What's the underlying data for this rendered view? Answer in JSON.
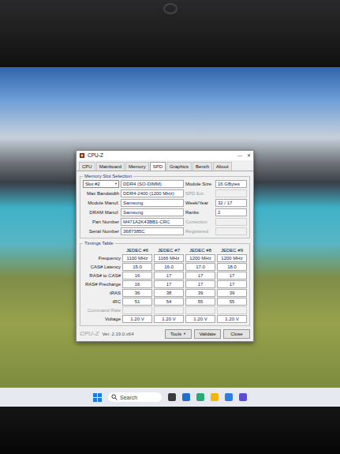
{
  "window": {
    "title": "CPU-Z",
    "controls": [
      "—",
      "✕"
    ]
  },
  "tabs": [
    {
      "label": "CPU",
      "selected": false
    },
    {
      "label": "Mainboard",
      "selected": false
    },
    {
      "label": "Memory",
      "selected": false
    },
    {
      "label": "SPD",
      "selected": true
    },
    {
      "label": "Graphics",
      "selected": false
    },
    {
      "label": "Bench",
      "selected": false
    },
    {
      "label": "About",
      "selected": false
    }
  ],
  "slot_selection": {
    "group_label": "Memory Slot Selection",
    "slot": "Slot #2",
    "arrow": "▼",
    "type": "DDR4 (SO-DIMM)",
    "size_label": "Module Size",
    "size_value": "16 GBytes",
    "rows": [
      {
        "label": "Max Bandwidth",
        "value": "DDR4-2400 (1200 MHz)",
        "side_label": "SPD Ext.",
        "side_value": "",
        "side_disabled": true
      },
      {
        "label": "Module Manuf.",
        "value": "Samsung",
        "side_label": "Week/Year",
        "side_value": "32 / 17",
        "side_disabled": false
      },
      {
        "label": "DRAM Manuf.",
        "value": "Samsung",
        "side_label": "Ranks",
        "side_value": "2",
        "side_disabled": false
      },
      {
        "label": "Part Number",
        "value": "M471A2K43BB1-CRC",
        "side_label": "Correction",
        "side_value": "",
        "side_disabled": true
      },
      {
        "label": "Serial Number",
        "value": "3687385C",
        "side_label": "Registered",
        "side_value": "",
        "side_disabled": true
      }
    ]
  },
  "timings": {
    "group_label": "Timings Table",
    "columns": [
      "JEDEC #6",
      "JEDEC #7",
      "JEDEC #8",
      "JEDEC #9"
    ],
    "rows": [
      {
        "label": "Frequency",
        "values": [
          "1100 MHz",
          "1166 MHz",
          "1200 MHz",
          "1200 MHz"
        ],
        "disabled": false
      },
      {
        "label": "CAS# Latency",
        "values": [
          "15.0",
          "16.0",
          "17.0",
          "18.0"
        ],
        "disabled": false
      },
      {
        "label": "RAS# to CAS#",
        "values": [
          "16",
          "17",
          "17",
          "17"
        ],
        "disabled": false
      },
      {
        "label": "RAS# Precharge",
        "values": [
          "16",
          "17",
          "17",
          "17"
        ],
        "disabled": false
      },
      {
        "label": "tRAS",
        "values": [
          "36",
          "38",
          "39",
          "39"
        ],
        "disabled": false
      },
      {
        "label": "tRC",
        "values": [
          "51",
          "54",
          "55",
          "55"
        ],
        "disabled": false
      },
      {
        "label": "Command Rate",
        "values": [
          "",
          "",
          "",
          ""
        ],
        "disabled": true
      },
      {
        "label": "Voltage",
        "values": [
          "1.20 V",
          "1.20 V",
          "1.20 V",
          "1.20 V"
        ],
        "disabled": false
      }
    ]
  },
  "footer": {
    "logo": "CPU-Z",
    "version": "Ver. 2.19.0.x64",
    "buttons": [
      {
        "label": "Tools",
        "arrow": "▼"
      },
      {
        "label": "Validate",
        "arrow": ""
      },
      {
        "label": "Close",
        "arrow": ""
      }
    ]
  },
  "taskbar": {
    "search_placeholder": "Search",
    "apps": [
      {
        "color": "#3b3b3b"
      },
      {
        "color": "#1f6fd1"
      },
      {
        "color": "#2aa876"
      },
      {
        "color": "#f2b705"
      },
      {
        "color": "#2f7de1"
      },
      {
        "color": "#5b4bd6"
      }
    ]
  }
}
